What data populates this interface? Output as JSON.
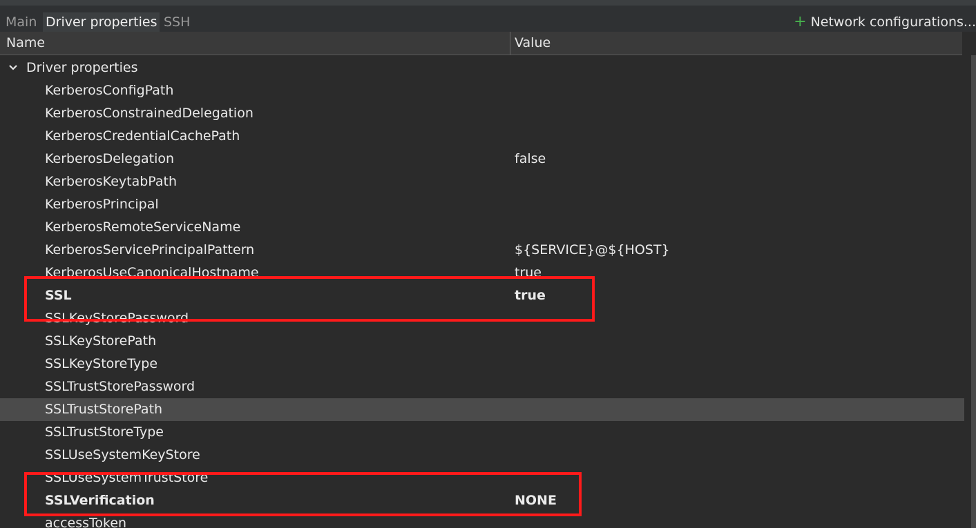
{
  "tabs": [
    {
      "label": "Main",
      "active": false
    },
    {
      "label": "Driver properties",
      "active": true
    },
    {
      "label": "SSH",
      "active": false
    }
  ],
  "network_button": {
    "icon": "plus-icon",
    "label": "Network configurations..."
  },
  "table": {
    "columns": {
      "name": "Name",
      "value": "Value"
    },
    "group": {
      "label": "Driver properties",
      "expanded": true,
      "icon": "chevron-down-icon"
    },
    "rows": [
      {
        "name": "KerberosConfigPath",
        "value": ""
      },
      {
        "name": "KerberosConstrainedDelegation",
        "value": ""
      },
      {
        "name": "KerberosCredentialCachePath",
        "value": ""
      },
      {
        "name": "KerberosDelegation",
        "value": "false"
      },
      {
        "name": "KerberosKeytabPath",
        "value": ""
      },
      {
        "name": "KerberosPrincipal",
        "value": ""
      },
      {
        "name": "KerberosRemoteServiceName",
        "value": ""
      },
      {
        "name": "KerberosServicePrincipalPattern",
        "value": "${SERVICE}@${HOST}"
      },
      {
        "name": "KerberosUseCanonicalHostname",
        "value": "true"
      },
      {
        "name": "SSL",
        "value": "true",
        "bold": true
      },
      {
        "name": "SSLKeyStorePassword",
        "value": ""
      },
      {
        "name": "SSLKeyStorePath",
        "value": ""
      },
      {
        "name": "SSLKeyStoreType",
        "value": ""
      },
      {
        "name": "SSLTrustStorePassword",
        "value": ""
      },
      {
        "name": "SSLTrustStorePath",
        "value": "",
        "selected": true
      },
      {
        "name": "SSLTrustStoreType",
        "value": ""
      },
      {
        "name": "SSLUseSystemKeyStore",
        "value": ""
      },
      {
        "name": "SSLUseSystemTrustStore",
        "value": ""
      },
      {
        "name": "SSLVerification",
        "value": "NONE",
        "bold": true
      },
      {
        "name": "accessToken",
        "value": ""
      }
    ]
  },
  "colors": {
    "highlight": "#ff1a1a",
    "selection": "#4b4b4b",
    "background": "#2b2b2b"
  }
}
